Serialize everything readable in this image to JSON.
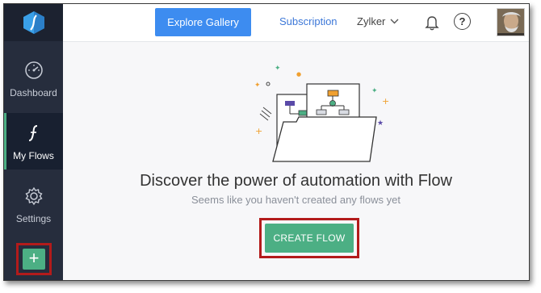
{
  "header": {
    "explore_label": "Explore Gallery",
    "subscription_label": "Subscription",
    "org_name": "Zylker",
    "help_glyph": "?"
  },
  "sidebar": {
    "items": [
      {
        "label": "Dashboard",
        "icon": "dashboard-gauge-icon"
      },
      {
        "label": "My Flows",
        "icon": "flow-script-icon",
        "active": true
      },
      {
        "label": "Settings",
        "icon": "gear-icon"
      }
    ],
    "add_glyph": "+"
  },
  "main": {
    "headline": "Discover the power of automation with Flow",
    "subline": "Seems like you haven't created any flows yet",
    "create_label": "CREATE FLOW"
  },
  "colors": {
    "sidebar": "#262d3d",
    "accent_green": "#4caf84",
    "primary_blue": "#3d8cf0",
    "highlight_red": "#b31b1b"
  }
}
